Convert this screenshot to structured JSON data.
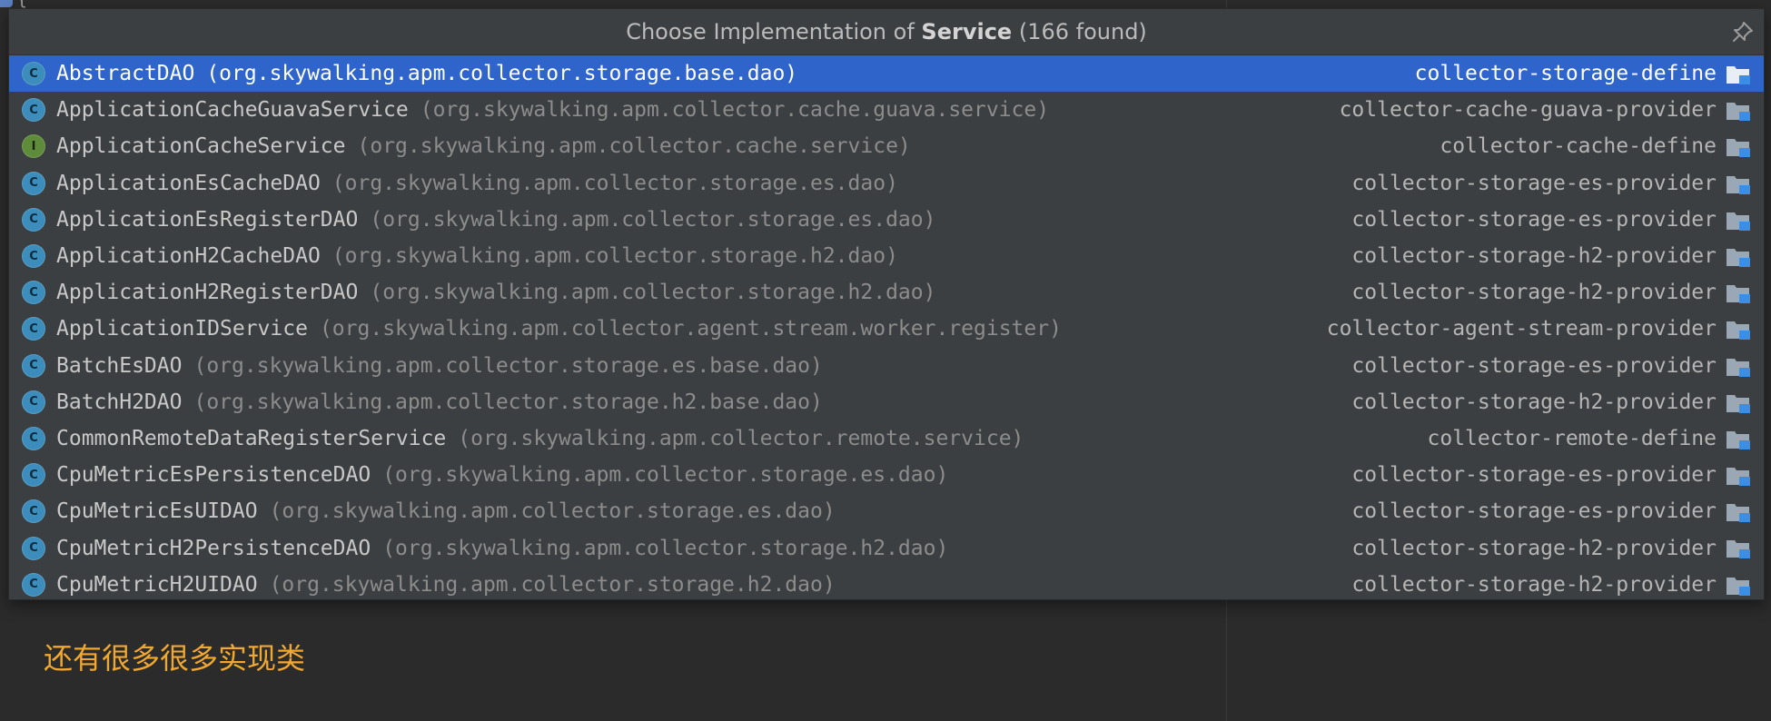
{
  "popup": {
    "title_prefix": "Choose Implementation of",
    "title_subject": "Service",
    "title_count": "(166 found)",
    "pin_icon": "pin-icon"
  },
  "items": [
    {
      "kind": "class",
      "badge": "C",
      "name": "AbstractDAO",
      "package": "(org.skywalking.apm.collector.storage.base.dao)",
      "module": "collector-storage-define",
      "selected": true
    },
    {
      "kind": "class",
      "badge": "C",
      "name": "ApplicationCacheGuavaService",
      "package": "(org.skywalking.apm.collector.cache.guava.service)",
      "module": "collector-cache-guava-provider"
    },
    {
      "kind": "interface",
      "badge": "I",
      "name": "ApplicationCacheService",
      "package": "(org.skywalking.apm.collector.cache.service)",
      "module": "collector-cache-define"
    },
    {
      "kind": "class",
      "badge": "C",
      "name": "ApplicationEsCacheDAO",
      "package": "(org.skywalking.apm.collector.storage.es.dao)",
      "module": "collector-storage-es-provider"
    },
    {
      "kind": "class",
      "badge": "C",
      "name": "ApplicationEsRegisterDAO",
      "package": "(org.skywalking.apm.collector.storage.es.dao)",
      "module": "collector-storage-es-provider"
    },
    {
      "kind": "class",
      "badge": "C",
      "name": "ApplicationH2CacheDAO",
      "package": "(org.skywalking.apm.collector.storage.h2.dao)",
      "module": "collector-storage-h2-provider"
    },
    {
      "kind": "class",
      "badge": "C",
      "name": "ApplicationH2RegisterDAO",
      "package": "(org.skywalking.apm.collector.storage.h2.dao)",
      "module": "collector-storage-h2-provider"
    },
    {
      "kind": "class",
      "badge": "C",
      "name": "ApplicationIDService",
      "package": "(org.skywalking.apm.collector.agent.stream.worker.register)",
      "module": "collector-agent-stream-provider"
    },
    {
      "kind": "class",
      "badge": "C",
      "name": "BatchEsDAO",
      "package": "(org.skywalking.apm.collector.storage.es.base.dao)",
      "module": "collector-storage-es-provider"
    },
    {
      "kind": "class",
      "badge": "C",
      "name": "BatchH2DAO",
      "package": "(org.skywalking.apm.collector.storage.h2.base.dao)",
      "module": "collector-storage-h2-provider"
    },
    {
      "kind": "class",
      "badge": "C",
      "name": "CommonRemoteDataRegisterService",
      "package": "(org.skywalking.apm.collector.remote.service)",
      "module": "collector-remote-define"
    },
    {
      "kind": "class",
      "badge": "C",
      "name": "CpuMetricEsPersistenceDAO",
      "package": "(org.skywalking.apm.collector.storage.es.dao)",
      "module": "collector-storage-es-provider"
    },
    {
      "kind": "class",
      "badge": "C",
      "name": "CpuMetricEsUIDAO",
      "package": "(org.skywalking.apm.collector.storage.es.dao)",
      "module": "collector-storage-es-provider"
    },
    {
      "kind": "class",
      "badge": "C",
      "name": "CpuMetricH2PersistenceDAO",
      "package": "(org.skywalking.apm.collector.storage.h2.dao)",
      "module": "collector-storage-h2-provider"
    },
    {
      "kind": "class",
      "badge": "C",
      "name": "CpuMetricH2UIDAO",
      "package": "(org.skywalking.apm.collector.storage.h2.dao)",
      "module": "collector-storage-h2-provider"
    }
  ],
  "note": "还有很多很多实现类",
  "colors": {
    "selection": "#2f65ca",
    "popup_bg": "#3c3f41",
    "note": "#f0a830",
    "class_badge": "#3c8dbc",
    "interface_badge": "#5f8c3a"
  }
}
